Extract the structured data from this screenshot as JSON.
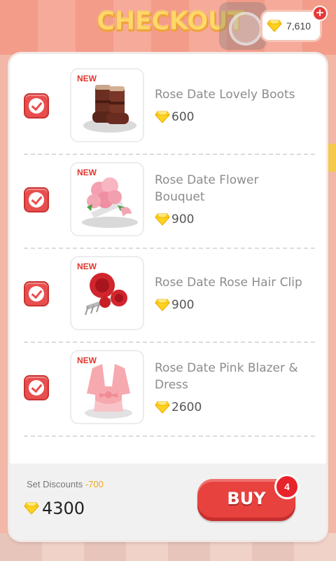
{
  "header": {
    "title": "CHECKOUT",
    "currency_value": "7,610",
    "plus_icon": "plus-icon"
  },
  "colors": {
    "accent_red": "#e8423f",
    "title_gold": "#ffd86b",
    "discount_orange": "#f0a81d"
  },
  "items": [
    {
      "badge": "NEW",
      "name": "Rose Date Lovely Boots",
      "price": "600",
      "checked": true,
      "icon": "boots-icon"
    },
    {
      "badge": "NEW",
      "name": "Rose Date Flower Bouquet",
      "price": "900",
      "checked": true,
      "icon": "bouquet-icon"
    },
    {
      "badge": "NEW",
      "name": "Rose Date Rose Hair Clip",
      "price": "900",
      "checked": true,
      "icon": "hair-clip-icon"
    },
    {
      "badge": "NEW",
      "name": "Rose Date Pink Blazer & Dress",
      "price": "2600",
      "checked": true,
      "icon": "blazer-dress-icon"
    }
  ],
  "footer": {
    "discount_label": "Set Discounts ",
    "discount_value": "-700",
    "total": "4300",
    "buy_label": "BUY",
    "buy_count": "4"
  }
}
